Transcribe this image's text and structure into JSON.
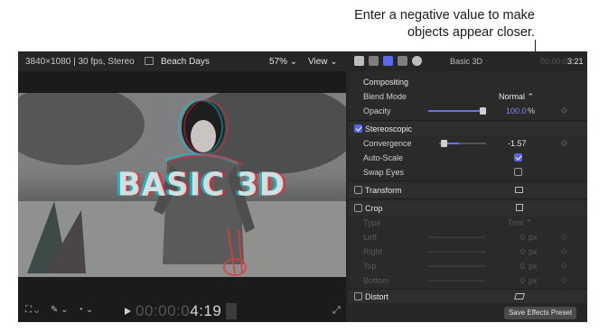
{
  "callout": {
    "line1": "Enter a negative value to make",
    "line2": "objects appear closer."
  },
  "viewer": {
    "specs": "3840×1080 | 30 fps, Stereo",
    "title": "Beach Days",
    "zoom": "57% ⌄",
    "view_menu": "View ⌄",
    "overlay_text": "BASIC 3D",
    "timecode_dim": "00:00:0",
    "timecode_bright": "4:19"
  },
  "inspector": {
    "title": "Basic 3D",
    "time_dim": "00:00:0",
    "time_bright": "3:21",
    "compositing": {
      "header": "Compositing",
      "blend_label": "Blend Mode",
      "blend_value": "Normal ⌃",
      "opacity_label": "Opacity",
      "opacity_value": "100.0",
      "opacity_unit": "%",
      "opacity_level": 1.0
    },
    "stereoscopic": {
      "header": "Stereoscopic",
      "enabled": true,
      "convergence_label": "Convergence",
      "convergence_value": "-1.57",
      "autoscale_label": "Auto-Scale",
      "autoscale": true,
      "swap_label": "Swap Eyes",
      "swap": false
    },
    "transform": {
      "header": "Transform"
    },
    "crop": {
      "header": "Crop",
      "type_label": "Type",
      "type_value": "Trim ⌃",
      "left_label": "Left",
      "right_label": "Right",
      "top_label": "Top",
      "bottom_label": "Bottom",
      "zero": "0",
      "unit": "px"
    },
    "distort": {
      "header": "Distort"
    },
    "preset_button": "Save Effects Preset"
  }
}
